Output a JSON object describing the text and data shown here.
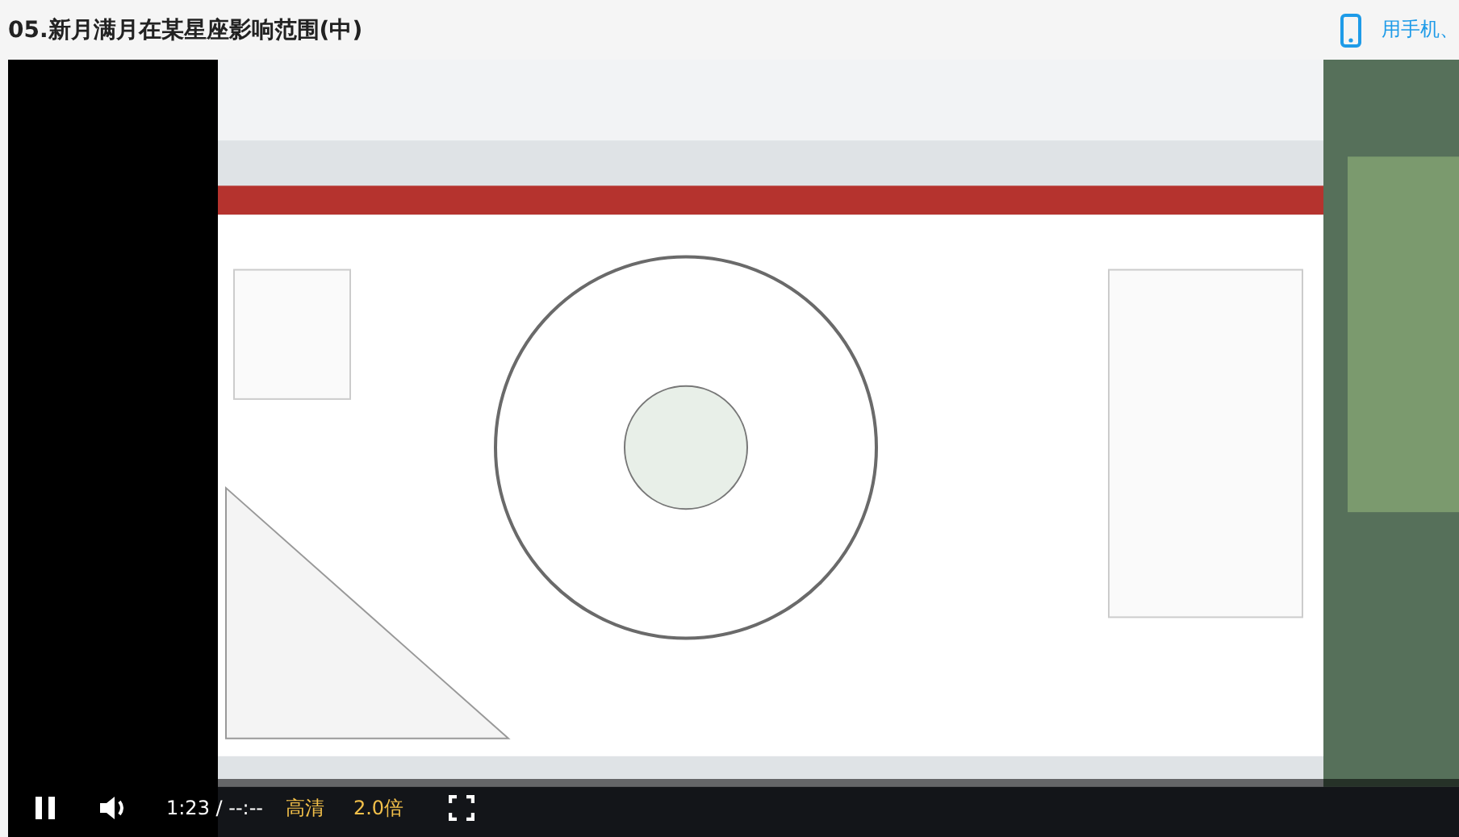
{
  "header": {
    "title": "05.新月满月在某星座影响范围(中)",
    "mobile_link": "用手机、"
  },
  "player": {
    "playing": true,
    "time": "1:23 / --:--",
    "quality": "高清",
    "speed": "2.0倍"
  }
}
